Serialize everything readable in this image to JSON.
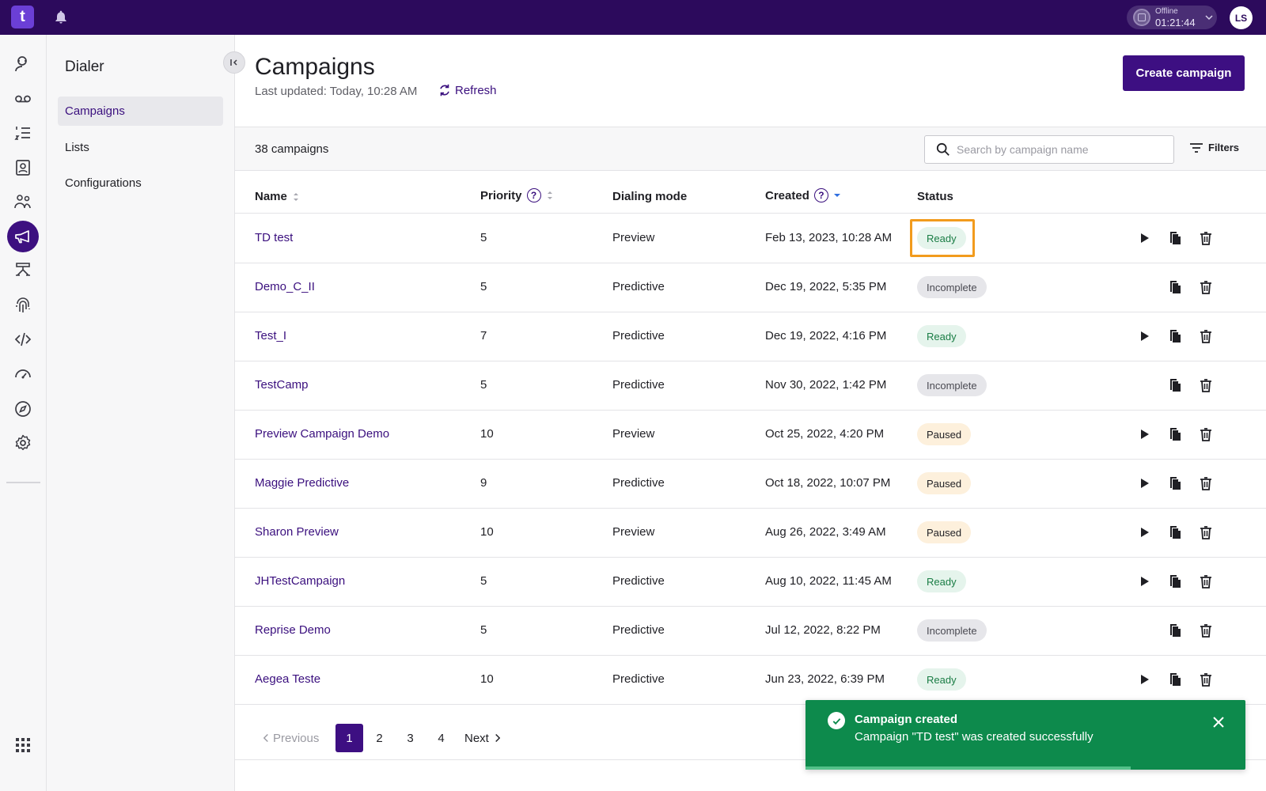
{
  "topbar": {
    "logo_text": "t",
    "presence_status": "Offline",
    "presence_timer": "01:21:44",
    "avatar_initials": "LS"
  },
  "rail": {
    "icons": [
      "agent-icon",
      "voicemail-icon",
      "list-icon",
      "contacts-icon",
      "team-icon",
      "campaign-icon",
      "workflow-icon",
      "fingerprint-icon",
      "code-icon",
      "dashboard-icon",
      "compass-icon",
      "settings-icon",
      "apps-grid-icon"
    ],
    "active": "campaign-icon"
  },
  "subnav": {
    "title": "Dialer",
    "items": [
      {
        "label": "Campaigns",
        "active": true
      },
      {
        "label": "Lists",
        "active": false
      },
      {
        "label": "Configurations",
        "active": false
      }
    ]
  },
  "header": {
    "title": "Campaigns",
    "last_updated": "Last updated: Today, 10:28 AM",
    "refresh_label": "Refresh",
    "create_label": "Create campaign"
  },
  "toolbar": {
    "count": "38 campaigns",
    "search_placeholder": "Search by campaign name",
    "filters_label": "Filters"
  },
  "table": {
    "columns": {
      "name": "Name",
      "priority": "Priority",
      "mode": "Dialing mode",
      "created": "Created",
      "status": "Status"
    },
    "rows": [
      {
        "name": "TD test",
        "priority": "5",
        "mode": "Preview",
        "created": "Feb 13, 2023, 10:28 AM",
        "status": "Ready",
        "status_class": "ready",
        "can_play": true,
        "highlighted": true
      },
      {
        "name": "Demo_C_II",
        "priority": "5",
        "mode": "Predictive",
        "created": "Dec 19, 2022, 5:35 PM",
        "status": "Incomplete",
        "status_class": "incomplete",
        "can_play": false
      },
      {
        "name": "Test_I",
        "priority": "7",
        "mode": "Predictive",
        "created": "Dec 19, 2022, 4:16 PM",
        "status": "Ready",
        "status_class": "ready",
        "can_play": true
      },
      {
        "name": "TestCamp",
        "priority": "5",
        "mode": "Predictive",
        "created": "Nov 30, 2022, 1:42 PM",
        "status": "Incomplete",
        "status_class": "incomplete",
        "can_play": false
      },
      {
        "name": "Preview Campaign Demo",
        "priority": "10",
        "mode": "Preview",
        "created": "Oct 25, 2022, 4:20 PM",
        "status": "Paused",
        "status_class": "paused",
        "can_play": true
      },
      {
        "name": "Maggie Predictive",
        "priority": "9",
        "mode": "Predictive",
        "created": "Oct 18, 2022, 10:07 PM",
        "status": "Paused",
        "status_class": "paused",
        "can_play": true
      },
      {
        "name": "Sharon Preview",
        "priority": "10",
        "mode": "Preview",
        "created": "Aug 26, 2022, 3:49 AM",
        "status": "Paused",
        "status_class": "paused",
        "can_play": true
      },
      {
        "name": "JHTestCampaign",
        "priority": "5",
        "mode": "Predictive",
        "created": "Aug 10, 2022, 11:45 AM",
        "status": "Ready",
        "status_class": "ready",
        "can_play": true
      },
      {
        "name": "Reprise Demo",
        "priority": "5",
        "mode": "Predictive",
        "created": "Jul 12, 2022, 8:22 PM",
        "status": "Incomplete",
        "status_class": "incomplete",
        "can_play": false
      },
      {
        "name": "Aegea Teste",
        "priority": "10",
        "mode": "Predictive",
        "created": "Jun 23, 2022, 6:39 PM",
        "status": "Ready",
        "status_class": "ready",
        "can_play": true
      }
    ]
  },
  "pagination": {
    "previous": "Previous",
    "pages": [
      "1",
      "2",
      "3",
      "4"
    ],
    "current": "1",
    "next": "Next"
  },
  "toast": {
    "title": "Campaign created",
    "message": "Campaign \"TD test\" was created successfully",
    "progress": 0.74
  },
  "colors": {
    "brand": "#2c0a5c",
    "accent": "#3d0f82",
    "highlight": "#f29b1d",
    "success": "#0d8a4c"
  }
}
